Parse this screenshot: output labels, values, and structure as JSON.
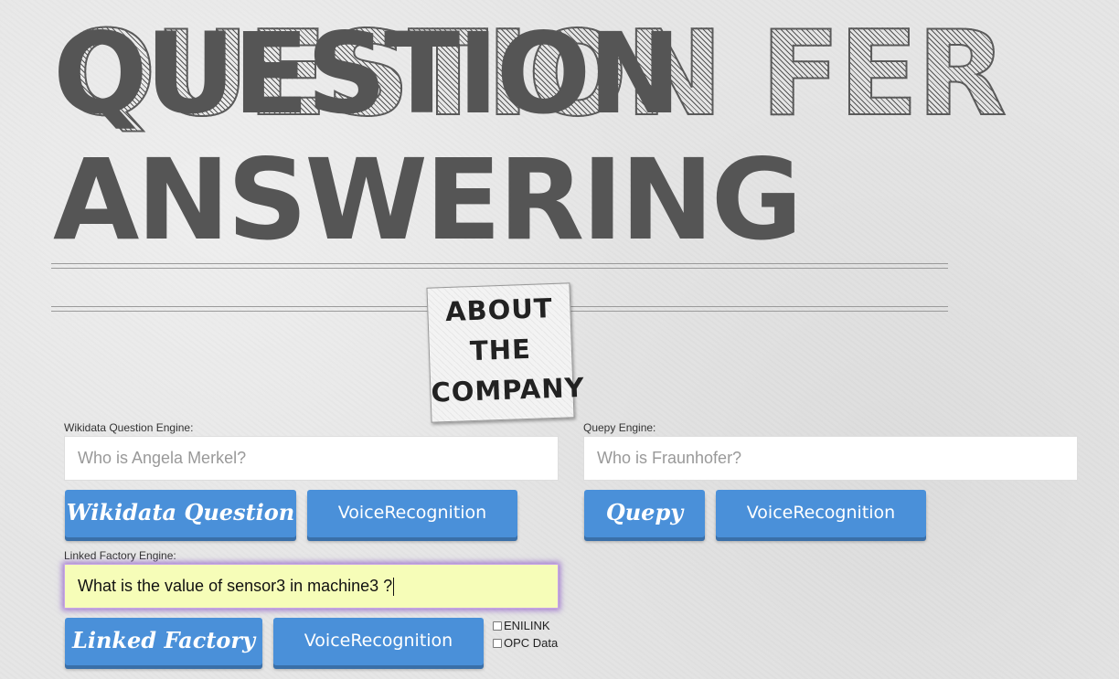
{
  "header": {
    "title_shadow": "QUESTION FER",
    "title_line1": "QUESTION",
    "title_line2": "ANSWERING",
    "sticker_line1": "ABOUT",
    "sticker_line2": "THE",
    "sticker_line3": "COMPANY"
  },
  "wikidata": {
    "label": "Wikidata Question Engine:",
    "placeholder": "Who is Angela Merkel?",
    "button_label": "Wikidata Question",
    "voice_label": "VoiceRecognition"
  },
  "quepy": {
    "label": "Quepy Engine:",
    "placeholder": "Who is Fraunhofer?",
    "button_label": "Quepy",
    "voice_label": "VoiceRecognition"
  },
  "linked": {
    "label": "Linked Factory Engine:",
    "value": "What is the value of sensor3 in machine3 ?",
    "button_label": "Linked Factory",
    "voice_label": "VoiceRecognition"
  },
  "options": {
    "enilink_label": "ENILINK",
    "opc_label": "OPC Data"
  },
  "colors": {
    "button": "#4a90d9",
    "title": "#555555",
    "focus_input_bg": "#f6fdb8"
  }
}
